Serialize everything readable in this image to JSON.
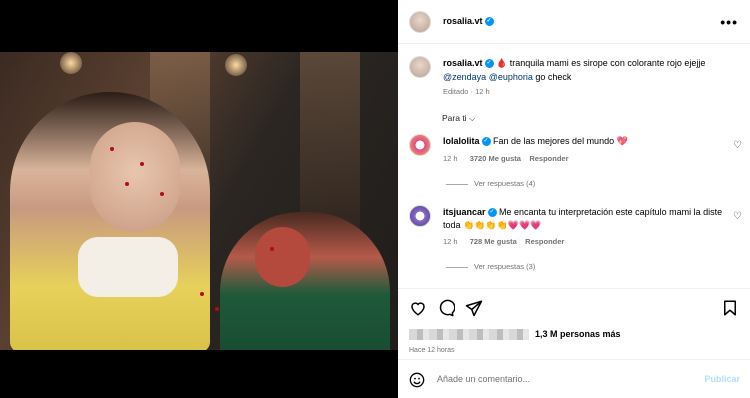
{
  "header": {
    "username": "rosalia.vt",
    "more_label": "•••"
  },
  "caption": {
    "username": "rosalia.vt",
    "emoji": "🩸",
    "text": " tranquila mami es sirope con colorante rojo ejejje",
    "mention1": "@zendaya",
    "mention2": "@euphoria",
    "tail": " go check",
    "edited": "Editado · 12 h"
  },
  "sort": {
    "label": "Para ti",
    "chevron": "⌵"
  },
  "comments": [
    {
      "username": "lolalolita",
      "text": " Fan de las mejores del mundo 💖",
      "time": "12 h",
      "likes": "3720 Me gusta",
      "reply": "Responder",
      "view_replies": "Ver respuestas (4)"
    },
    {
      "username": "itsjuancar",
      "text": " Me encanta tu interpretación este capítulo mami la diste toda 👏👏👏👏💗💗💗",
      "time": "12 h",
      "likes": "728 Me gusta",
      "reply": "Responder",
      "view_replies": "Ver respuestas (3)"
    }
  ],
  "likes": {
    "text": "1,3 M personas más"
  },
  "time_ago": "Hace 12 horas",
  "add_comment": {
    "placeholder": "Añade un comentario...",
    "publish": "Publicar"
  },
  "colors": {
    "accent": "#0095f6",
    "link": "#00376b",
    "muted": "#737373",
    "heart": "#e8175d"
  }
}
